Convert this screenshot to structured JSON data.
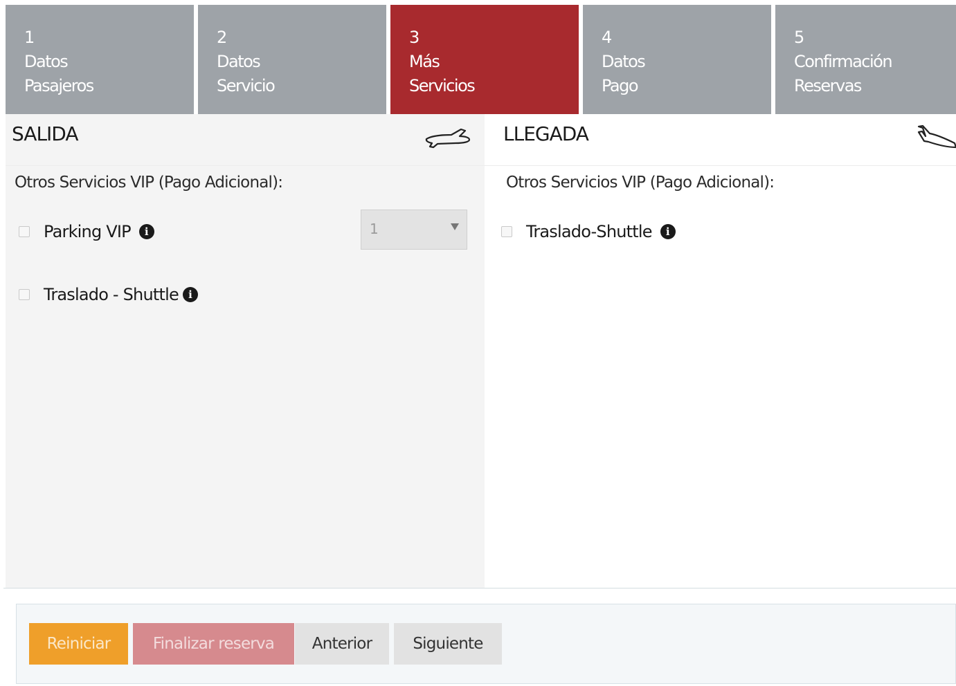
{
  "steps": [
    {
      "num": "1",
      "line1": "Datos",
      "line2": "Pasajeros",
      "active": false
    },
    {
      "num": "2",
      "line1": "Datos",
      "line2": "Servicio",
      "active": false
    },
    {
      "num": "3",
      "line1": "Más",
      "line2": "Servicios",
      "active": true
    },
    {
      "num": "4",
      "line1": "Datos",
      "line2": "Pago",
      "active": false
    },
    {
      "num": "5",
      "line1": "Confirmación",
      "line2": "Reservas",
      "active": false
    }
  ],
  "departure": {
    "title": "SALIDA",
    "icon": "plane-takeoff-icon",
    "section_label": "Otros Servicios VIP (Pago Adicional):",
    "options": [
      {
        "label": "Parking VIP",
        "checked": false,
        "quantity": "1"
      },
      {
        "label": "Traslado - Shuttle",
        "checked": false
      }
    ]
  },
  "arrival": {
    "title": "LLEGADA",
    "icon": "plane-landing-icon",
    "section_label": "Otros Servicios VIP (Pago Adicional):",
    "options": [
      {
        "label": "Traslado-Shuttle",
        "checked": false
      }
    ]
  },
  "buttons": {
    "reset": "Reiniciar",
    "finish": "Finalizar reserva",
    "previous": "Anterior",
    "next": "Siguiente"
  },
  "colors": {
    "step_inactive": "#9ea3a8",
    "step_active": "#a82a2e",
    "reset": "#ef9f2a",
    "finish": "#d68a8e"
  }
}
